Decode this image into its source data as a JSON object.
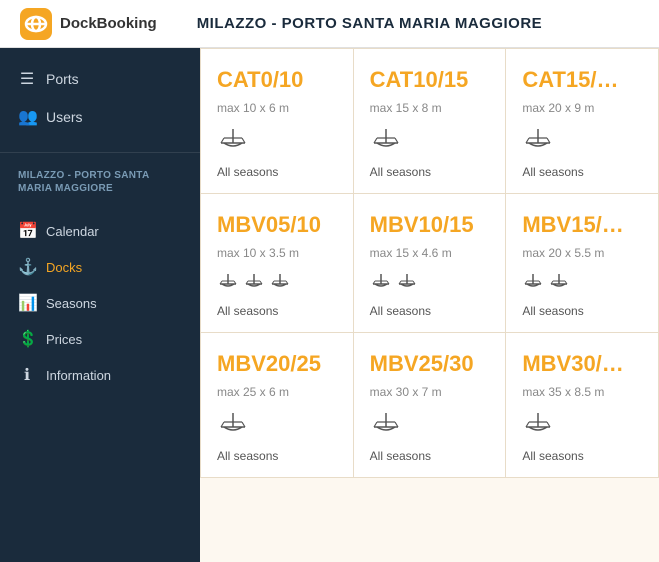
{
  "header": {
    "logo_text": "DockBooking",
    "title": "MILAZZO - PORTO SANTA MARIA MAGGIORE"
  },
  "sidebar": {
    "port_label": "MILAZZO - PORTO SANTA\nMARIA MAGGIORE",
    "top_items": [
      {
        "id": "ports",
        "label": "Ports",
        "icon": "☰"
      },
      {
        "id": "users",
        "label": "Users",
        "icon": "👤"
      }
    ],
    "sub_items": [
      {
        "id": "calendar",
        "label": "Calendar",
        "icon": "📅"
      },
      {
        "id": "docks",
        "label": "Docks",
        "icon": "🚢",
        "active": true
      },
      {
        "id": "seasons",
        "label": "Seasons",
        "icon": "📊"
      },
      {
        "id": "prices",
        "label": "Prices",
        "icon": "💲"
      },
      {
        "id": "information",
        "label": "Information",
        "icon": "ℹ"
      }
    ]
  },
  "cards": [
    {
      "id": "cat0-10",
      "title": "CAT0/10",
      "dims": "max 10 x 6 m",
      "boats": 1,
      "season": "All seasons"
    },
    {
      "id": "cat10-15",
      "title": "CAT10/15",
      "dims": "max 15 x 8 m",
      "boats": 1,
      "season": "All seasons"
    },
    {
      "id": "cat15-x",
      "title": "CAT15/…",
      "dims": "max 20 x 9 m",
      "boats": 1,
      "season": "All seasons"
    },
    {
      "id": "mbv05-10",
      "title": "MBV05/10",
      "dims": "max 10 x 3.5 m",
      "boats": 3,
      "season": "All seasons"
    },
    {
      "id": "mbv10-15",
      "title": "MBV10/15",
      "dims": "max 15 x 4.6 m",
      "boats": 2,
      "season": "All seasons"
    },
    {
      "id": "mbv15-x",
      "title": "MBV15/…",
      "dims": "max 20 x 5.5 m",
      "boats": 2,
      "season": "All seasons"
    },
    {
      "id": "mbv20-25",
      "title": "MBV20/25",
      "dims": "max 25 x 6 m",
      "boats": 1,
      "season": "All seasons"
    },
    {
      "id": "mbv25-30",
      "title": "MBV25/30",
      "dims": "max 30 x 7 m",
      "boats": 1,
      "season": "All seasons"
    },
    {
      "id": "mbv30-x",
      "title": "MBV30/…",
      "dims": "max 35 x 8.5 m",
      "boats": 1,
      "season": "All seasons"
    }
  ],
  "icons": {
    "ports": "☰",
    "users": "👥",
    "calendar": "📅",
    "docks": "⚓",
    "seasons": "📊",
    "prices": "💲",
    "information": "ℹ"
  }
}
